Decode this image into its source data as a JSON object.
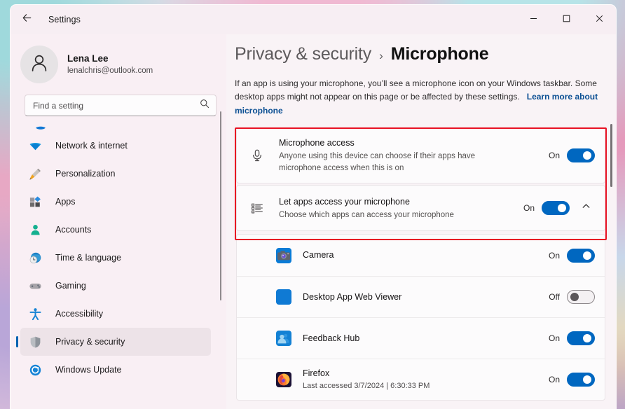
{
  "window": {
    "app_title": "Settings",
    "back_icon": "back-arrow-icon",
    "controls": {
      "minimize": "minimize-icon",
      "maximize": "maximize-icon",
      "close": "close-icon"
    }
  },
  "account": {
    "name": "Lena Lee",
    "email": "lenalchris@outlook.com",
    "avatar_icon": "person-avatar-icon"
  },
  "search": {
    "placeholder": "Find a setting",
    "value": "",
    "icon": "search-icon"
  },
  "sidebar": {
    "items": [
      {
        "label": "Network & internet",
        "icon": "wifi-icon",
        "active": false
      },
      {
        "label": "Personalization",
        "icon": "paintbrush-icon",
        "active": false
      },
      {
        "label": "Apps",
        "icon": "apps-grid-icon",
        "active": false
      },
      {
        "label": "Accounts",
        "icon": "person-icon",
        "active": false
      },
      {
        "label": "Time & language",
        "icon": "clock-globe-icon",
        "active": false
      },
      {
        "label": "Gaming",
        "icon": "gamepad-icon",
        "active": false
      },
      {
        "label": "Accessibility",
        "icon": "accessibility-person-icon",
        "active": false
      },
      {
        "label": "Privacy & security",
        "icon": "shield-icon",
        "active": true
      },
      {
        "label": "Windows Update",
        "icon": "update-refresh-icon",
        "active": false
      }
    ],
    "clipped_top_item_icon": "bluetooth-devices-icon"
  },
  "breadcrumb": {
    "parent": "Privacy & security",
    "separator": "›",
    "current": "Microphone"
  },
  "page": {
    "description": "If an app is using your microphone, you’ll see a microphone icon on your Windows taskbar. Some desktop apps might not appear on this page or be affected by these settings.",
    "link_text": "Learn more about microphone"
  },
  "highlight": {
    "color": "#e81123"
  },
  "settings_cards": [
    {
      "title": "Microphone access",
      "subtitle": "Anyone using this device can choose if their apps have microphone access when this is on",
      "icon": "microphone-icon",
      "state_label": "On",
      "state": "on",
      "has_chevron": false
    },
    {
      "title": "Let apps access your microphone",
      "subtitle": "Choose which apps can access your microphone",
      "icon": "app-list-icon",
      "state_label": "On",
      "state": "on",
      "has_chevron": true,
      "chevron_icon": "chevron-up-icon"
    }
  ],
  "apps": [
    {
      "name": "Camera",
      "icon": "camera-app-icon",
      "icon_color": "#0a7bd6",
      "state_label": "On",
      "state": "on",
      "meta": ""
    },
    {
      "name": "Desktop App Web Viewer",
      "icon": "desktop-app-web-viewer-icon",
      "icon_color": "#0f7ad4",
      "state_label": "Off",
      "state": "off",
      "meta": ""
    },
    {
      "name": "Feedback Hub",
      "icon": "feedback-hub-icon",
      "icon_color": "#1381d4",
      "state_label": "On",
      "state": "on",
      "meta": ""
    },
    {
      "name": "Firefox",
      "icon": "firefox-icon",
      "icon_color": "#1b1135",
      "state_label": "On",
      "state": "on",
      "meta": "Last accessed 3/7/2024  |  6:30:33 PM"
    }
  ],
  "colors": {
    "accent_blue": "#0067c0",
    "nav_accent": "#0063b1",
    "link_blue": "#0b4f93",
    "highlight_red": "#e81123",
    "window_bg": "#f9f3f6",
    "sidebar_bg": "#f9eff4"
  }
}
